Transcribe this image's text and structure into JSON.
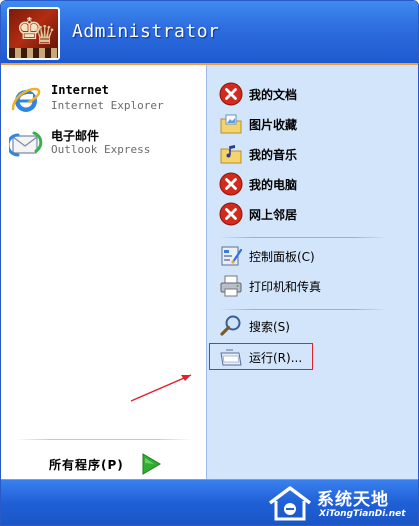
{
  "header": {
    "username": "Administrator"
  },
  "left": {
    "pinned": [
      {
        "title": "Internet",
        "subtitle": "Internet Explorer",
        "icon": "internet-explorer-icon"
      },
      {
        "title": "电子邮件",
        "subtitle": "Outlook Express",
        "icon": "outlook-express-icon"
      }
    ],
    "all_programs_label": "所有程序(P)"
  },
  "right": {
    "items": [
      {
        "label": "我的文档",
        "icon": "error-x-icon",
        "bold": true
      },
      {
        "label": "图片收藏",
        "icon": "folder-pictures-icon",
        "bold": true
      },
      {
        "label": "我的音乐",
        "icon": "folder-music-icon",
        "bold": true
      },
      {
        "label": "我的电脑",
        "icon": "error-x-icon",
        "bold": true
      },
      {
        "label": "网上邻居",
        "icon": "error-x-icon",
        "bold": true
      },
      {
        "label": "控制面板(C)",
        "icon": "control-panel-icon",
        "bold": false
      },
      {
        "label": "打印机和传真",
        "icon": "printer-icon",
        "bold": false
      },
      {
        "label": "搜索(S)",
        "icon": "search-icon",
        "bold": false
      },
      {
        "label": "运行(R)...",
        "icon": "run-icon",
        "bold": false
      }
    ]
  },
  "watermark": {
    "brand": "系统天地",
    "site": "XiTongTianDi.net"
  },
  "colors": {
    "header_blue": "#2f6fe0",
    "right_pane": "#d3e5fa",
    "highlight": "#e0202a",
    "accent_orange": "#f0a040"
  }
}
